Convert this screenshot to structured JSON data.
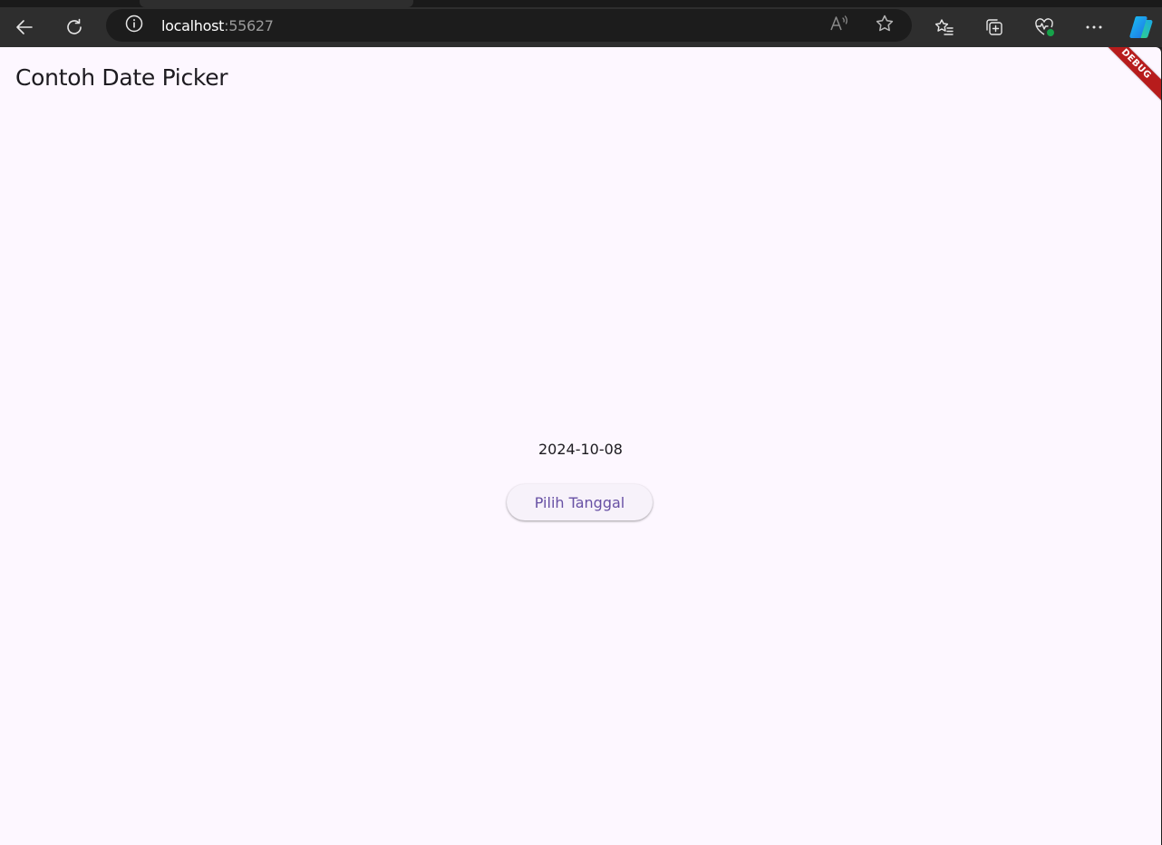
{
  "browser": {
    "url_host": "localhost",
    "url_port": ":55627",
    "icons": {
      "back": "back-arrow-icon",
      "reload": "reload-icon",
      "site_info": "info-icon",
      "read_aloud": "read-aloud-icon",
      "favorite": "star-icon",
      "favorites": "favorites-list-icon",
      "collections": "collections-icon",
      "performance": "heartbeat-icon",
      "menu": "more-icon",
      "copilot": "copilot-icon"
    }
  },
  "app": {
    "title": "Contoh Date Picker",
    "selected_date": "2024-10-08",
    "pick_button_label": "Pilih Tanggal",
    "debug_banner": "DEBUG",
    "colors": {
      "background": "#fdf7ff",
      "primary": "#6750a4",
      "debug_banner": "#b71c1c"
    }
  }
}
